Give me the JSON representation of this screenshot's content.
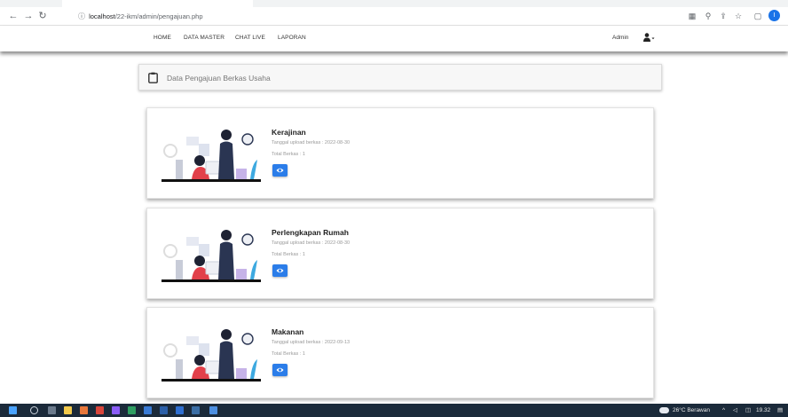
{
  "browser": {
    "url_host": "localhost",
    "url_path": "/22-ikm/admin/pengajuan.php",
    "back_icon": "arrow-left-icon",
    "forward_icon": "arrow-right-icon",
    "reload_icon": "reload-icon",
    "profile_initial": "I"
  },
  "navbar": {
    "links": [
      "HOME",
      "DATA MASTER",
      "CHAT LIVE",
      "LAPORAN"
    ],
    "user_label": "Admin"
  },
  "page": {
    "title": "Data Pengajuan Berkas Usaha"
  },
  "cards": [
    {
      "name": "Kerajinan",
      "date": "Tanggal upload berkas : 2022-08-30",
      "total": "Total Berkas : 1"
    },
    {
      "name": "Perlengkapan Rumah",
      "date": "Tanggal upload berkas : 2022-08-30",
      "total": "Total Berkas : 1"
    },
    {
      "name": "Makanan",
      "date": "Tanggal upload berkas : 2022-09-13",
      "total": "Total Berkas : 1"
    }
  ],
  "taskbar": {
    "weather": "26°C Berawan",
    "time": "19.32"
  },
  "colors": {
    "accent": "#2b7de9",
    "taskbar": "#1b2a3a"
  }
}
